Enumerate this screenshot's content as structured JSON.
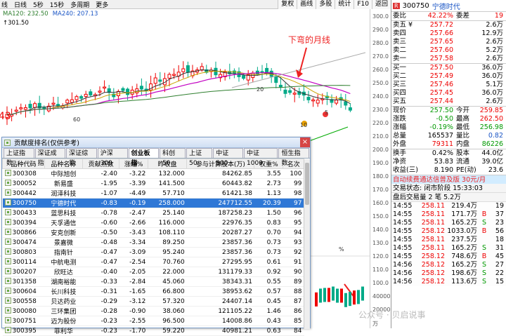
{
  "topbar": {
    "periods": [
      "线",
      "日线",
      "5秒",
      "15秒",
      "多周期",
      "更多"
    ],
    "buttons": [
      "复权",
      "画线",
      "多股",
      "统计",
      "F10",
      "返回"
    ]
  },
  "chart": {
    "ma_legend": [
      {
        "label": "MA120: 232.50",
        "color": "#2f7f2f"
      },
      {
        "label": "MA240: 207.13",
        "color": "#1a55c5"
      }
    ],
    "high_label": "301.50",
    "annotation": "下弯的月线",
    "left_price": "43",
    "markers": [
      "20",
      "60",
      "10",
      "5"
    ],
    "axis_ticks": [
      "300.0",
      "290.0",
      "280.0",
      "270.0",
      "260.0",
      "250.0",
      "240.0",
      "230.0",
      "220.0",
      "210.0",
      "200.0",
      "190.0",
      "180.0",
      "170.0",
      "160.0",
      "150.0",
      "140.0",
      "130.0",
      "120.0",
      "110.0",
      "100.0",
      "40000",
      "20000",
      "万"
    ],
    "percent_label": "%"
  },
  "quote": {
    "r_badge": "R",
    "code": "300750",
    "name": "宁德时代",
    "weibi": {
      "label": "委比",
      "value": "42.22%",
      "label2": "委差",
      "value2": "19"
    },
    "sells": [
      {
        "label": "卖五 ¥",
        "price": "257.72",
        "vol": "2.6万"
      },
      {
        "label": "卖四",
        "price": "257.66",
        "vol": "12.9万"
      },
      {
        "label": "卖三",
        "price": "257.65",
        "vol": "2.6万"
      },
      {
        "label": "卖二",
        "price": "257.60",
        "vol": "5.2万"
      },
      {
        "label": "卖一",
        "price": "257.58",
        "vol": "2.6万"
      }
    ],
    "buys": [
      {
        "label": "买一",
        "price": "257.50",
        "vol": "36.0万"
      },
      {
        "label": "买二",
        "price": "257.49",
        "vol": "36.0万"
      },
      {
        "label": "买三",
        "price": "257.46",
        "vol": "5.1万"
      },
      {
        "label": "买四",
        "price": "257.45",
        "vol": "36.0万"
      },
      {
        "label": "买五",
        "price": "257.44",
        "vol": "2.6万"
      }
    ],
    "stats": [
      {
        "l1": "现价",
        "v1": "257.50",
        "l2": "今开",
        "v2": "259.85",
        "c1": "green",
        "c2": "red"
      },
      {
        "l1": "涨跌",
        "v1": "-0.50",
        "l2": "最高",
        "v2": "262.50",
        "c1": "green",
        "c2": "red"
      },
      {
        "l1": "涨幅",
        "v1": "-0.19%",
        "l2": "最低",
        "v2": "256.98",
        "c1": "green",
        "c2": "green"
      },
      {
        "l1": "总量",
        "v1": "165537",
        "l2": "量比",
        "v2": "0.82",
        "c1": "",
        "c2": "blue"
      },
      {
        "l1": "外盘",
        "v1": "79311",
        "l2": "内盘",
        "v2": "86226",
        "c1": "red",
        "c2": "green"
      }
    ],
    "stats2": [
      {
        "l1": "换手",
        "v1": "0.42%",
        "l2": "股本",
        "v2": "44.0亿"
      },
      {
        "l1": "净资",
        "v1": "53.83",
        "l2": "流通",
        "v2": "39.0亿"
      },
      {
        "l1": "收益(三)",
        "v1": "8.190",
        "l2": "PE(动)",
        "v2": "23.6"
      }
    ],
    "promo": "自动续费通达信普及版  30元/月",
    "status_line": "交易状态: 闭市阶段  15:33:03",
    "after_line": "盘后交易量 2 笔 5.2万",
    "ticks": [
      {
        "t": "14:55",
        "p": "258.11",
        "v": "219.4万",
        "d": "",
        "n": "19"
      },
      {
        "t": "14:55",
        "p": "258.11",
        "v": "171.7万",
        "d": "B",
        "n": "37"
      },
      {
        "t": "14:55",
        "p": "258.11",
        "v": "165.2万",
        "d": "S",
        "n": "23"
      },
      {
        "t": "14:55",
        "p": "258.12",
        "v": "1033.0万",
        "d": "B",
        "n": "56"
      },
      {
        "t": "14:55",
        "p": "258.11",
        "v": "237.5万",
        "d": "",
        "n": "18"
      },
      {
        "t": "14:55",
        "p": "258.11",
        "v": "165.2万",
        "d": "S",
        "n": "31"
      },
      {
        "t": "14:55",
        "p": "258.12",
        "v": "748.6万",
        "d": "B",
        "n": "45"
      },
      {
        "t": "14:56",
        "p": "258.12",
        "v": "165.2万",
        "d": "S",
        "n": "27"
      },
      {
        "t": "14:56",
        "p": "258.12",
        "v": "198.6万",
        "d": "S",
        "n": "22"
      },
      {
        "t": "14:56",
        "p": "258.12",
        "v": "113.6万",
        "d": "S",
        "n": "15"
      }
    ]
  },
  "dialog": {
    "title": "贡献度排名(仅供参考)",
    "close": "×",
    "tabs": [
      "上证指数",
      "深证成指",
      "深证综指",
      "沪深300",
      "创业板指",
      "科创50",
      "上证50",
      "中证500",
      "中证1000",
      "恒生指数"
    ],
    "active_tab": 4,
    "columns": [
      "品种代码",
      "品种名称",
      "贡献点数",
      "涨幅%",
      "昨收盘",
      "参与计算股本(万)",
      "权重%",
      "名次"
    ],
    "rows": [
      [
        "300308",
        "中际旭创",
        "-2.40",
        "-3.22",
        "132.000",
        "84262.85",
        "3.55",
        "100"
      ],
      [
        "300052",
        "新易盛",
        "-1.95",
        "-3.39",
        "141.500",
        "60443.82",
        "2.73",
        "99"
      ],
      [
        "300442",
        "润泽科技",
        "-1.07",
        "-4.49",
        "57.710",
        "61421.38",
        "1.13",
        "98"
      ],
      [
        "300750",
        "宁德时代",
        "-0.83",
        "-0.19",
        "258.000",
        "247712.55",
        "20.39",
        "97"
      ],
      [
        "300433",
        "蓝思科技",
        "-0.78",
        "-2.47",
        "25.140",
        "187258.23",
        "1.50",
        "96"
      ],
      [
        "300394",
        "天孚通信",
        "-0.60",
        "-2.66",
        "116.000",
        "22976.35",
        "0.83",
        "95"
      ],
      [
        "300866",
        "安克创新",
        "-0.50",
        "-3.43",
        "108.110",
        "20287.27",
        "0.70",
        "94"
      ],
      [
        "300474",
        "景嘉微",
        "-0.48",
        "-3.34",
        "89.250",
        "23857.36",
        "0.73",
        "93"
      ],
      [
        "300803",
        "指南针",
        "-0.47",
        "-3.09",
        "95.240",
        "23857.36",
        "0.73",
        "92"
      ],
      [
        "300114",
        "中航电测",
        "-0.47",
        "-2.54",
        "70.760",
        "27295.95",
        "0.61",
        "91"
      ],
      [
        "300207",
        "欣旺达",
        "-0.40",
        "-2.05",
        "22.000",
        "131179.33",
        "0.92",
        "90"
      ],
      [
        "301358",
        "湖南裕能",
        "-0.33",
        "-2.84",
        "45.060",
        "38343.31",
        "0.55",
        "89"
      ],
      [
        "300604",
        "长川科技",
        "-0.31",
        "-1.65",
        "66.800",
        "38953.62",
        "0.57",
        "88"
      ],
      [
        "300558",
        "贝达药业",
        "-0.29",
        "-3.12",
        "57.320",
        "24407.14",
        "0.45",
        "87"
      ],
      [
        "300080",
        "三环集团",
        "-0.28",
        "-0.90",
        "38.060",
        "121105.22",
        "1.46",
        "86"
      ],
      [
        "300751",
        "迈为股份",
        "-0.23",
        "-2.55",
        "96.500",
        "14008.86",
        "0.43",
        "85"
      ],
      [
        "300395",
        "菲利华",
        "-0.23",
        "-1.70",
        "59.220",
        "40981.21",
        "0.63",
        "84"
      ]
    ]
  },
  "watermark": "公众号 · 贝启说事"
}
